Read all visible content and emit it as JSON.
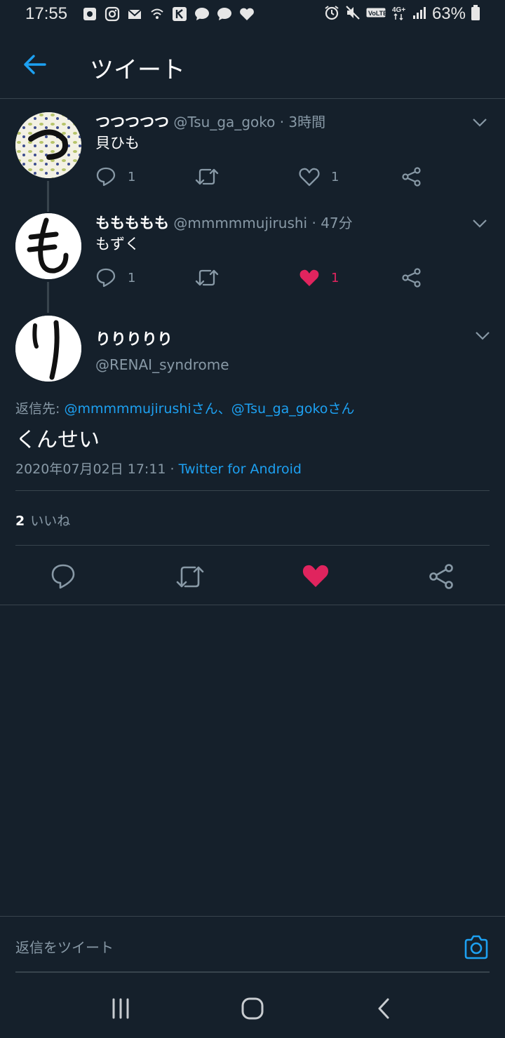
{
  "status_bar": {
    "time": "17:55",
    "battery": "63%",
    "left_icons": [
      "notification-icon",
      "instagram-icon",
      "mail-icon",
      "wifi-calling-icon",
      "app-icon",
      "chat-bubble-icon",
      "chat-bubble-icon",
      "heart-icon"
    ],
    "right_icons": [
      "alarm-icon",
      "mute-icon",
      "volte-icon",
      "4g-icon",
      "signal-icon",
      "battery-icon"
    ]
  },
  "header": {
    "title": "ツイート",
    "back_icon": "arrow-left-icon"
  },
  "thread": [
    {
      "name": "つつつつつ",
      "handle": "@Tsu_ga_goko",
      "time": "· 3時間",
      "text": "貝ひも",
      "avatar_char": "つ",
      "reply_count": "1",
      "like_count": "1",
      "liked": false
    },
    {
      "name": "ももももも",
      "handle": "@mmmmmujirushi",
      "time": "· 47分",
      "text": "もずく",
      "avatar_char": "も",
      "reply_count": "1",
      "like_count": "1",
      "liked": true
    }
  ],
  "main_tweet": {
    "name": "りりりりり",
    "handle": "@RENAI_syndrome",
    "avatar_char": "り",
    "reply_label": "返信先: ",
    "reply_targets": "@mmmmmujirushiさん、@Tsu_ga_gokoさん",
    "text": "くんせい",
    "date": "2020年07月02日 17:11 · ",
    "source": "Twitter for Android",
    "likes_count": "2",
    "likes_label": "いいね",
    "liked": true
  },
  "reply_bar": {
    "placeholder": "返信をツイート"
  },
  "colors": {
    "background": "#15202b",
    "accent": "#1da1f2",
    "like": "#e0245e",
    "muted": "#8899a6",
    "border": "#38444d"
  }
}
